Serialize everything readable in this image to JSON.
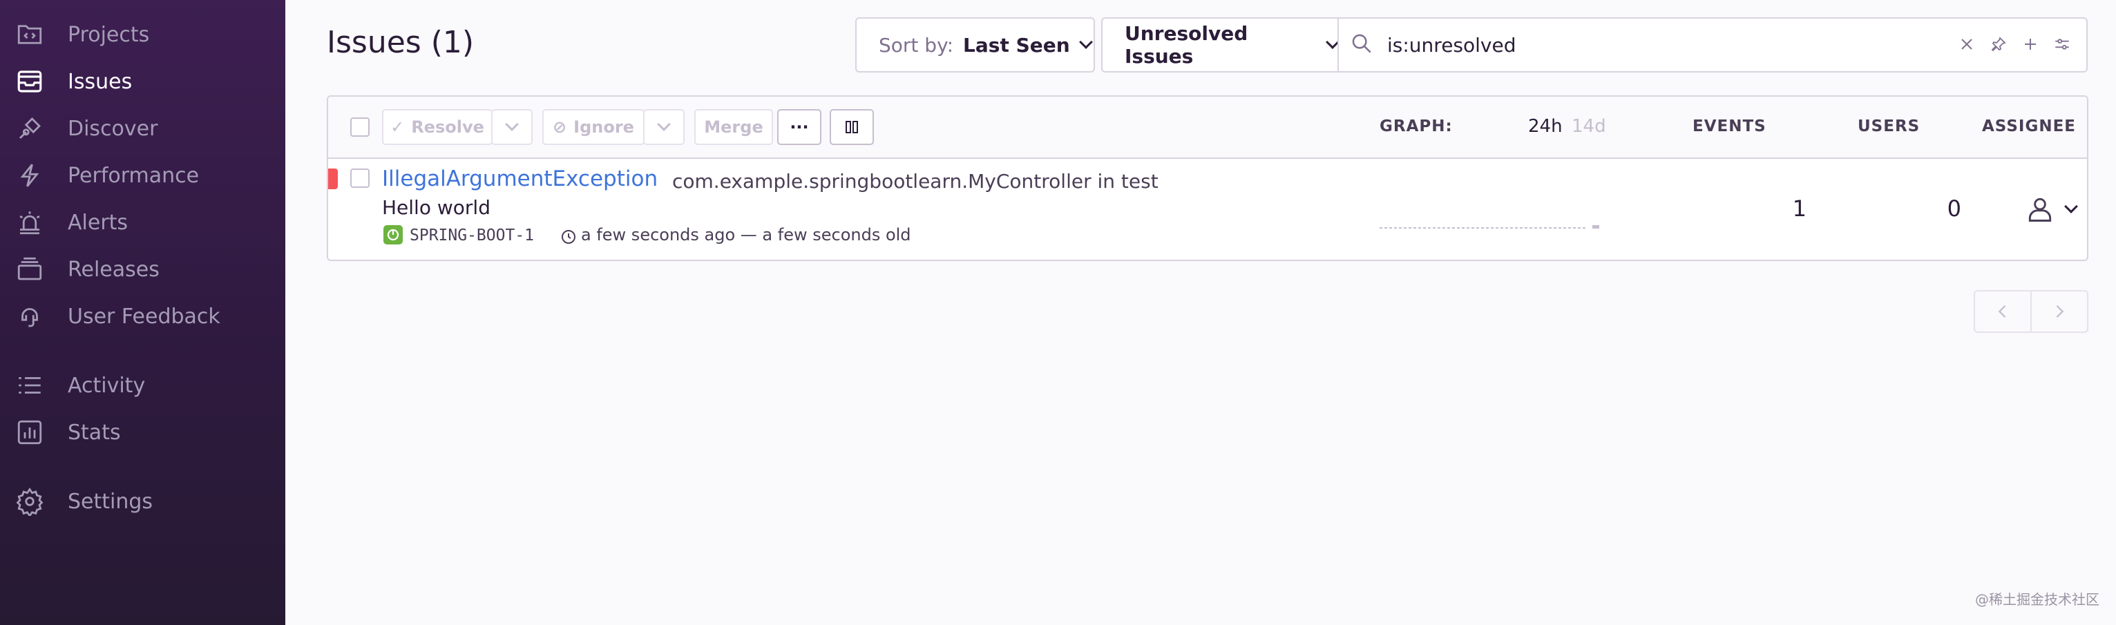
{
  "sidebar": {
    "items": [
      {
        "label": "Projects",
        "icon": "projects-icon"
      },
      {
        "label": "Issues",
        "icon": "issues-icon",
        "active": true
      },
      {
        "label": "Discover",
        "icon": "discover-icon"
      },
      {
        "label": "Performance",
        "icon": "performance-icon"
      },
      {
        "label": "Alerts",
        "icon": "alerts-icon"
      },
      {
        "label": "Releases",
        "icon": "releases-icon"
      },
      {
        "label": "User Feedback",
        "icon": "user-feedback-icon"
      },
      {
        "label": "Activity",
        "icon": "activity-icon"
      },
      {
        "label": "Stats",
        "icon": "stats-icon"
      },
      {
        "label": "Settings",
        "icon": "settings-icon"
      }
    ]
  },
  "header": {
    "title": "Issues (1)",
    "sort_label": "Sort by:",
    "sort_value": "Last Seen",
    "saved_search": "Unresolved Issues",
    "search_query": "is:unresolved"
  },
  "toolbar": {
    "resolve": "Resolve",
    "ignore": "Ignore",
    "merge": "Merge",
    "more": "···",
    "graph_label": "GRAPH:",
    "period_24h": "24h",
    "period_14d": "14d",
    "events_label": "EVENTS",
    "users_label": "USERS",
    "assignee_label": "ASSIGNEE"
  },
  "issue": {
    "title": "IllegalArgumentException",
    "culprit": "com.example.springbootlearn.MyController in test",
    "message": "Hello world",
    "short_id": "SPRING-BOOT-1",
    "times": "a few seconds ago — a few seconds old",
    "events": "1",
    "users": "0",
    "severity_color": "#f55459"
  },
  "watermark": "@稀土掘金技术社区",
  "colors": {
    "accent_link": "#3d74db",
    "sidebar_bg": "#2f1a3f",
    "project_icon": "#6db33f"
  }
}
